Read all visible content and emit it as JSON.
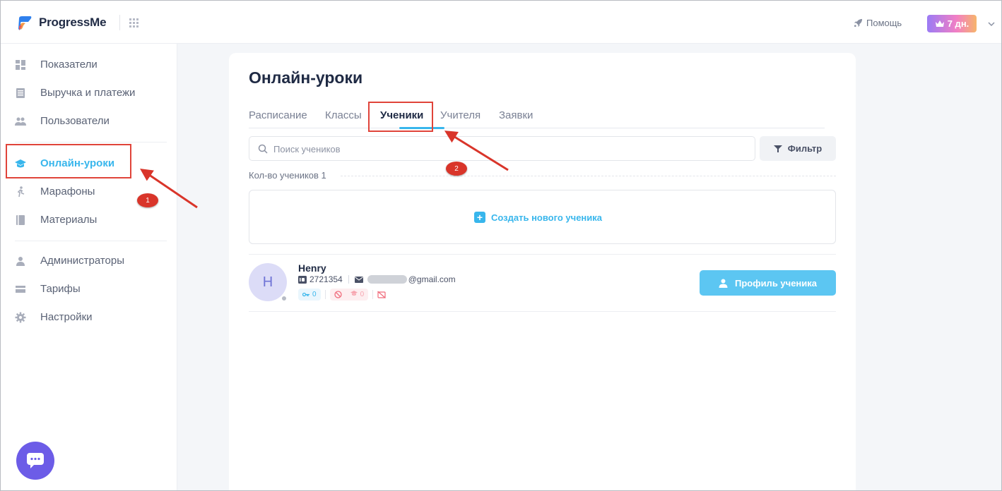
{
  "header": {
    "brand": "ProgressMe",
    "help_label": "Помощь",
    "trial_badge": "7 дн."
  },
  "sidebar": {
    "items": [
      {
        "label": "Показатели",
        "icon": "dashboard-icon"
      },
      {
        "label": "Выручка и платежи",
        "icon": "receipt-icon"
      },
      {
        "label": "Пользователи",
        "icon": "users-icon"
      },
      {
        "label": "Онлайн-уроки",
        "icon": "graduation-cap-icon",
        "active": true
      },
      {
        "label": "Марафоны",
        "icon": "runner-icon"
      },
      {
        "label": "Материалы",
        "icon": "book-icon"
      },
      {
        "label": "Администраторы",
        "icon": "user-icon"
      },
      {
        "label": "Тарифы",
        "icon": "wallet-icon"
      },
      {
        "label": "Настройки",
        "icon": "gear-icon"
      }
    ]
  },
  "main": {
    "title": "Онлайн-уроки",
    "tabs": [
      {
        "label": "Расписание"
      },
      {
        "label": "Классы"
      },
      {
        "label": "Ученики",
        "active": true
      },
      {
        "label": "Учителя"
      },
      {
        "label": "Заявки"
      }
    ],
    "search": {
      "placeholder": "Поиск учеников",
      "value": ""
    },
    "filter_label": "Фильтр",
    "count_label": "Кол-во учеников 1",
    "create_label": "Создать нового ученика",
    "students": [
      {
        "initial": "H",
        "name": "Henry",
        "id": "2721354",
        "email_suffix": "@gmail.com",
        "keys": "0",
        "missed": "0",
        "profile_button": "Профиль ученика"
      }
    ]
  },
  "annotations": {
    "marker_1": "1",
    "marker_2": "2"
  },
  "colors": {
    "accent": "#38b6ec",
    "annotation": "#e0443a",
    "chat": "#6c5ce7"
  }
}
